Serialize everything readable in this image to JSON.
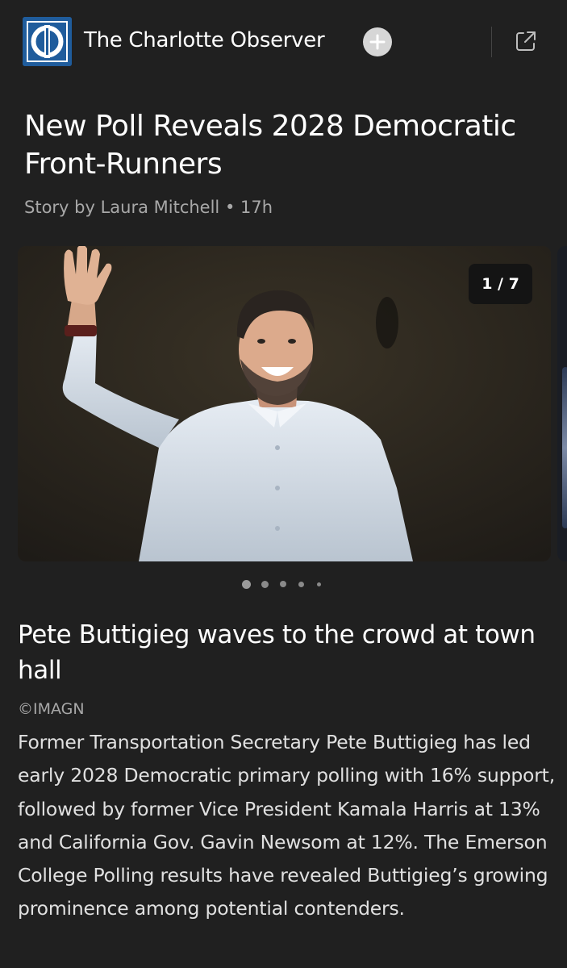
{
  "header": {
    "source_name": "The Charlotte Observer",
    "logo_icon": "charlotte-observer-logo",
    "follow_icon": "plus-icon",
    "share_icon": "open-external-icon"
  },
  "article": {
    "headline": "New Poll Reveals 2028 Democratic Front-Runners",
    "byline": "Story by Laura Mitchell • 17h"
  },
  "gallery": {
    "counter": "1 / 7",
    "current_index": 1,
    "total": 7,
    "dot_count": 5,
    "caption_title": "Pete Buttigieg waves to the crowd at town hall",
    "credit": "©IMAGN",
    "description": "Former Transportation Secretary Pete Buttigieg has led early 2028 Democratic primary polling with 16% support, followed by former Vice President Kamala Harris at 13% and California Gov. Gavin Newsom at 12%. The Emerson College Polling results have revealed Buttigieg’s growing prominence among potential contenders."
  },
  "colors": {
    "background": "#202020",
    "text": "#ffffff",
    "muted_text": "#a8a8a8",
    "logo_blue": "#1f5c9c"
  }
}
